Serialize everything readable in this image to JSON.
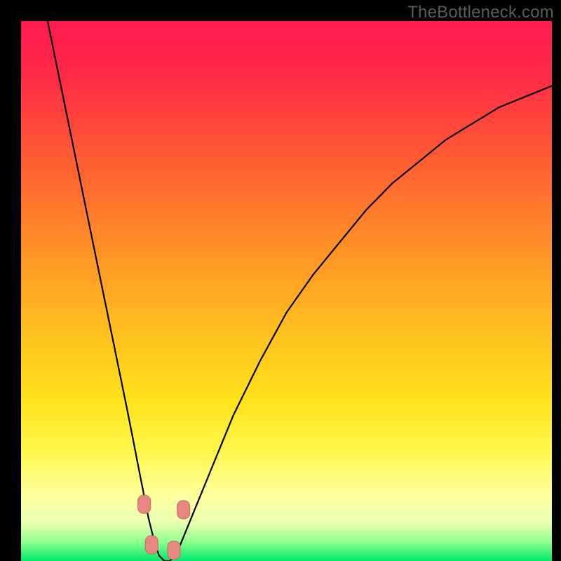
{
  "watermark": "TheBottleneck.com",
  "colors": {
    "gradient_stops": [
      {
        "offset": 0.0,
        "color": "#ff1a4f"
      },
      {
        "offset": 0.1,
        "color": "#ff2a47"
      },
      {
        "offset": 0.25,
        "color": "#ff5a34"
      },
      {
        "offset": 0.4,
        "color": "#ff8a28"
      },
      {
        "offset": 0.55,
        "color": "#ffb81f"
      },
      {
        "offset": 0.7,
        "color": "#ffe21a"
      },
      {
        "offset": 0.8,
        "color": "#fff74f"
      },
      {
        "offset": 0.88,
        "color": "#ffffa0"
      },
      {
        "offset": 0.93,
        "color": "#e8ffb0"
      },
      {
        "offset": 0.965,
        "color": "#8dff8d"
      },
      {
        "offset": 1.0,
        "color": "#00e86b"
      }
    ],
    "curve": "#000000",
    "marker_fill": "#e6887f",
    "marker_stroke": "#c46a62"
  },
  "chart_data": {
    "type": "line",
    "title": "",
    "xlabel": "",
    "ylabel": "",
    "xlim": [
      0,
      100
    ],
    "ylim": [
      0,
      100
    ],
    "grid": false,
    "legend": false,
    "series": [
      {
        "name": "bottleneck-curve",
        "x": [
          5,
          7.5,
          10,
          12.5,
          15,
          17.5,
          20,
          21,
          22,
          23,
          24,
          25,
          26,
          27,
          28,
          29,
          30,
          32.5,
          35,
          40,
          45,
          50,
          55,
          60,
          65,
          70,
          75,
          80,
          85,
          90,
          95,
          100
        ],
        "y": [
          100,
          88,
          76,
          64,
          52,
          40,
          28,
          23,
          18,
          13,
          8,
          4,
          1,
          0,
          0,
          1,
          3,
          9,
          15,
          27,
          37,
          46,
          53,
          59,
          65,
          70,
          74,
          78,
          81,
          84,
          86,
          88
        ]
      }
    ],
    "markers": [
      {
        "x": 23.2,
        "y": 10.5
      },
      {
        "x": 24.6,
        "y": 3.0
      },
      {
        "x": 28.8,
        "y": 2.0
      },
      {
        "x": 30.6,
        "y": 9.5
      }
    ],
    "optimum_x": 27
  }
}
